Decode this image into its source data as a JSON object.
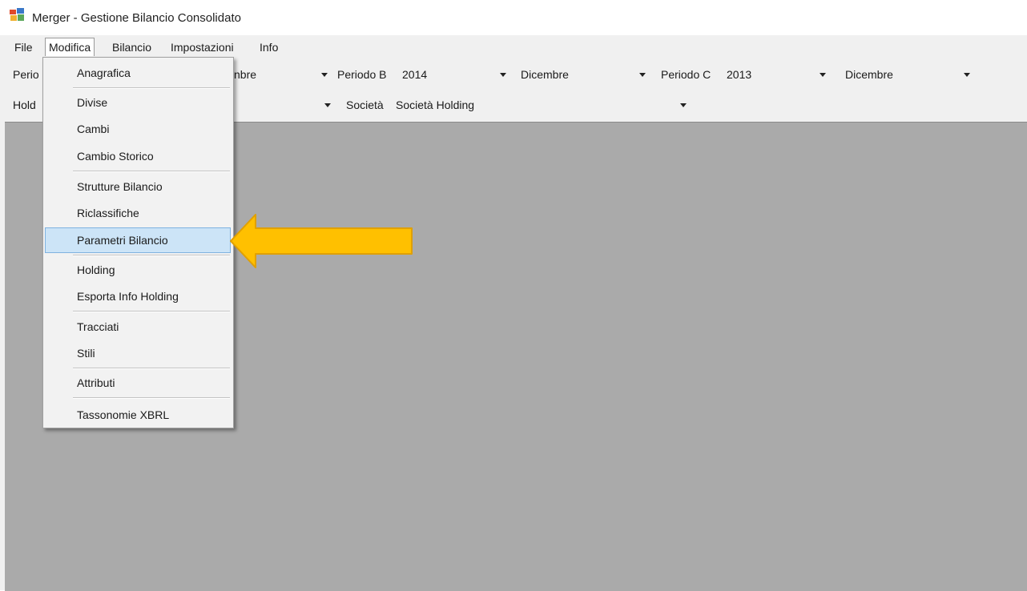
{
  "window": {
    "title": "Merger - Gestione Bilancio Consolidato",
    "icon": "app-window-icon"
  },
  "menubar": {
    "items": [
      {
        "label": "File"
      },
      {
        "label": "Modifica",
        "active": true
      },
      {
        "label": "Bilancio"
      },
      {
        "label": "Impostazioni"
      },
      {
        "label": "Info"
      }
    ]
  },
  "toolbar": {
    "row1": {
      "periodo_a_label_partial": "Perio",
      "periodo_a_month_partial": "nbre",
      "periodo_b_label": "Periodo B",
      "periodo_b_year": "2014",
      "periodo_b_month": "Dicembre",
      "periodo_c_label": "Periodo C",
      "periodo_c_year": "2013",
      "periodo_c_month": "Dicembre"
    },
    "row2": {
      "holding_label_partial": "Hold",
      "societa_label": "Società",
      "societa_value": "Società Holding"
    }
  },
  "dropdown": {
    "menu": "Modifica",
    "selected": "Parametri Bilancio",
    "items": [
      "Anagrafica",
      "Divise",
      "Cambi",
      "Cambio Storico",
      "Strutture Bilancio",
      "Riclassifiche",
      "Parametri Bilancio",
      "Holding",
      "Esporta Info Holding",
      "Tracciati",
      "Stili",
      "Attributi",
      "Tassonomie XBRL"
    ]
  },
  "colors": {
    "menu_bg": "#f0f0f0",
    "workspace_bg": "#aaaaaa",
    "highlight_bg": "#cce4f7",
    "highlight_border": "#7fb2e0",
    "annotation_fill": "#ffc000",
    "annotation_stroke": "#e0a000"
  }
}
